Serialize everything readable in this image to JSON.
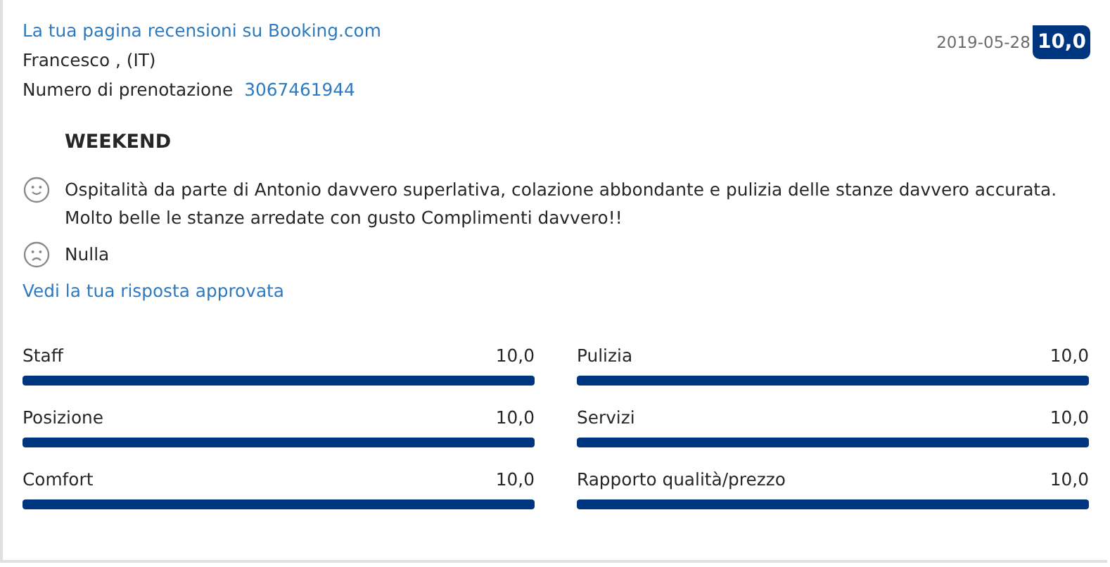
{
  "header": {
    "link": "La tua pagina recensioni su Booking.com",
    "guest": "Francesco , (IT)",
    "booking_label": "Numero di prenotazione",
    "booking_number": "3067461944",
    "date": "2019-05-28",
    "score": "10,0"
  },
  "review": {
    "title": "WEEKEND",
    "comments": [
      {
        "kind": "positive",
        "text": "Ospitalità da parte di Antonio davvero superlativa, colazione abbondante e pulizia delle stanze davvero accurata. Molto belle le stanze arredate con gusto Complimenti davvero!!"
      },
      {
        "kind": "negative",
        "text": "Nulla"
      }
    ],
    "response_link": "Vedi la tua risposta approvata"
  },
  "scores": [
    {
      "label": "Staff",
      "value": "10,0",
      "level": 1
    },
    {
      "label": "Pulizia",
      "value": "10,0",
      "level": 1
    },
    {
      "label": "Posizione",
      "value": "10,0",
      "level": 1
    },
    {
      "label": "Servizi",
      "value": "10,0",
      "level": 1
    },
    {
      "label": "Comfort",
      "value": "10,0",
      "level": 1
    },
    {
      "label": "Rapporto qualità/prezzo",
      "value": "10,0",
      "level": 1
    }
  ]
}
